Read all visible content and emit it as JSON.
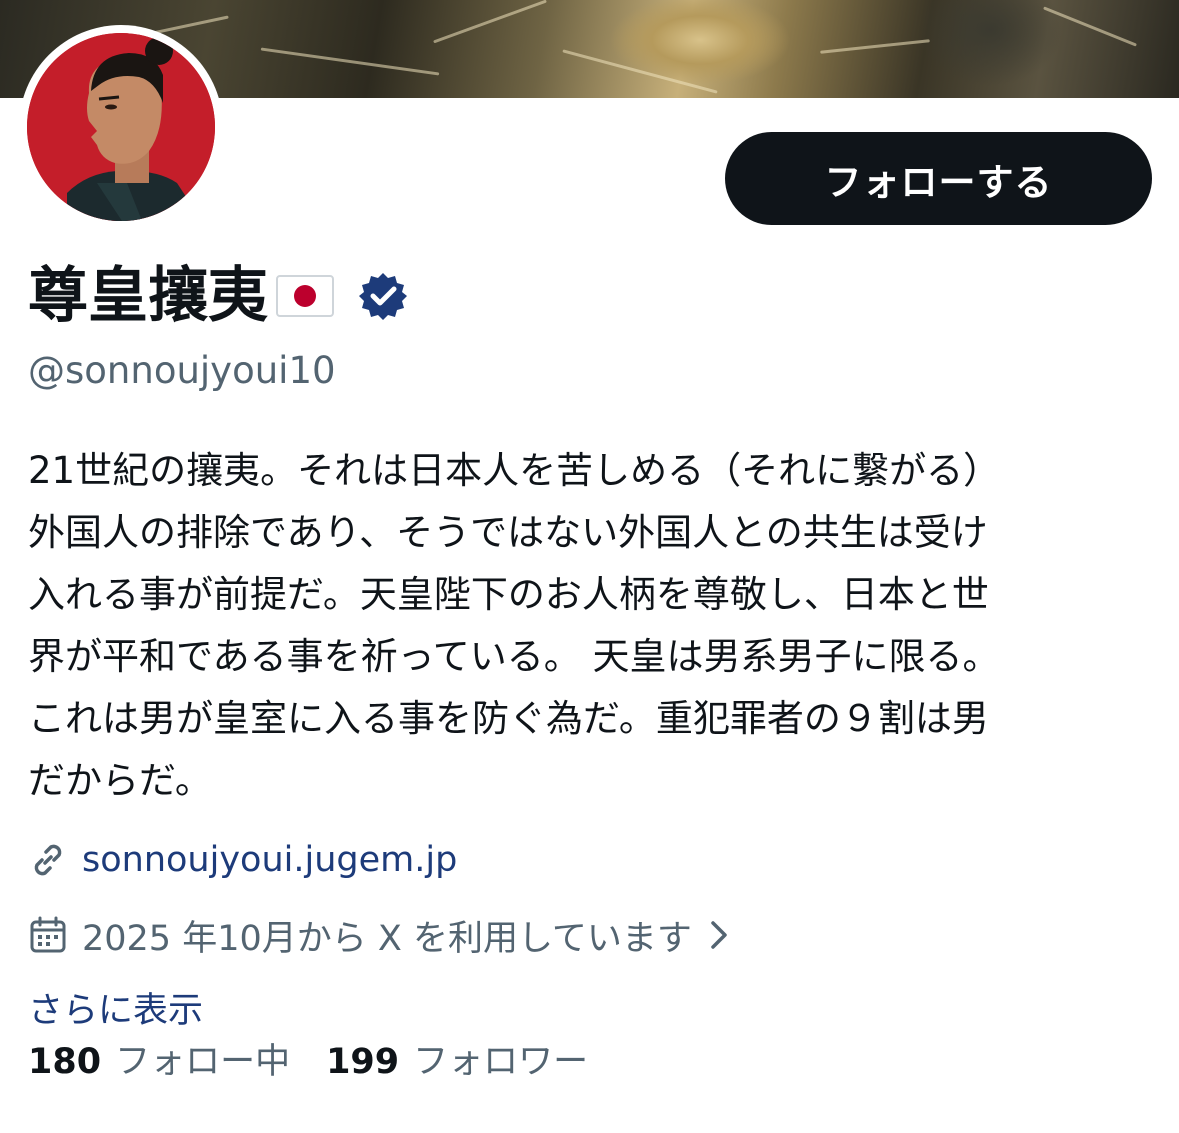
{
  "profile": {
    "follow_button_label": "フォローする",
    "display_name": "尊皇攘夷",
    "handle": "@sonnoujyoui10",
    "bio_lines": [
      "21世紀の攘夷。それは日本人を苦しめる（それに繋がる）",
      "外国人の排除であり、そうではない外国人との共生は受け",
      "入れる事が前提だ。天皇陛下のお人柄を尊敬し、日本と世",
      "界が平和である事を祈っている。 天皇は男系男子に限る。",
      "これは男が皇室に入る事を防ぐ為だ。重犯罪者の９割は男",
      "だからだ。"
    ],
    "website": "sonnoujyoui.jugem.jp",
    "joined": "2025 年10月から X を利用しています",
    "show_more_label": "さらに表示",
    "following_count": "180",
    "following_label": "フォロー中",
    "followers_count": "199",
    "followers_label": "フォロワー"
  },
  "icons": {
    "flag": "japan-flag-icon",
    "verified": "verified-badge-icon",
    "link": "link-icon",
    "calendar": "calendar-icon",
    "chevron": "chevron-right-icon"
  },
  "colors": {
    "text_primary": "#0f1419",
    "text_secondary": "#536471",
    "link": "#1d3b7a",
    "button_bg": "#0f1419",
    "verified": "#1d3b7a",
    "avatar_bg": "#c41e2a",
    "flag_red": "#bc002d"
  }
}
